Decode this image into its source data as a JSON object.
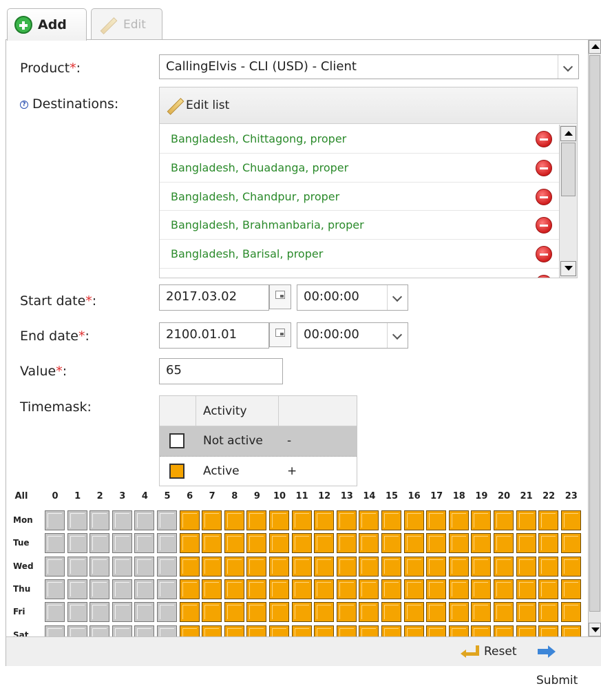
{
  "tabs": {
    "add_label": "Add",
    "edit_label": "Edit"
  },
  "form": {
    "product_label": "Product",
    "required_mark": "*",
    "colon": ":",
    "product_value": "CallingElvis - CLI (USD) - Client",
    "destinations_label": "Destinations:",
    "edit_list_label": "Edit list",
    "destinations": [
      "Bangladesh, Chittagong, proper",
      "Bangladesh, Chuadanga, proper",
      "Bangladesh, Chandpur, proper",
      "Bangladesh, Brahmanbaria, proper",
      "Bangladesh, Barisal, proper"
    ],
    "start_date_label": "Start date",
    "start_date_value": "2017.03.02",
    "start_time_value": "00:00:00",
    "end_date_label": "End date",
    "end_date_value": "2100.01.01",
    "end_time_value": "00:00:00",
    "value_label": "Value",
    "value_value": "65",
    "timemask_label": "Timemask:"
  },
  "legend": {
    "header": "Activity",
    "rows": [
      {
        "name": "Not active",
        "symbol": "-",
        "color": "#ffffff"
      },
      {
        "name": "Active",
        "symbol": "+",
        "color": "#f5a400"
      }
    ]
  },
  "timemask": {
    "all_label": "All",
    "hours": [
      "0",
      "1",
      "2",
      "3",
      "4",
      "5",
      "6",
      "7",
      "8",
      "9",
      "10",
      "11",
      "12",
      "13",
      "14",
      "15",
      "16",
      "17",
      "18",
      "19",
      "20",
      "21",
      "22",
      "23"
    ],
    "days": [
      "Mon",
      "Tue",
      "Wed",
      "Thu",
      "Fri",
      "Sat"
    ],
    "active_from_hour": 6,
    "active_color": "#f5a400",
    "inactive_color": "#c8c8c8"
  },
  "footer": {
    "reset_label": "Reset",
    "submit_label": "Submit"
  }
}
